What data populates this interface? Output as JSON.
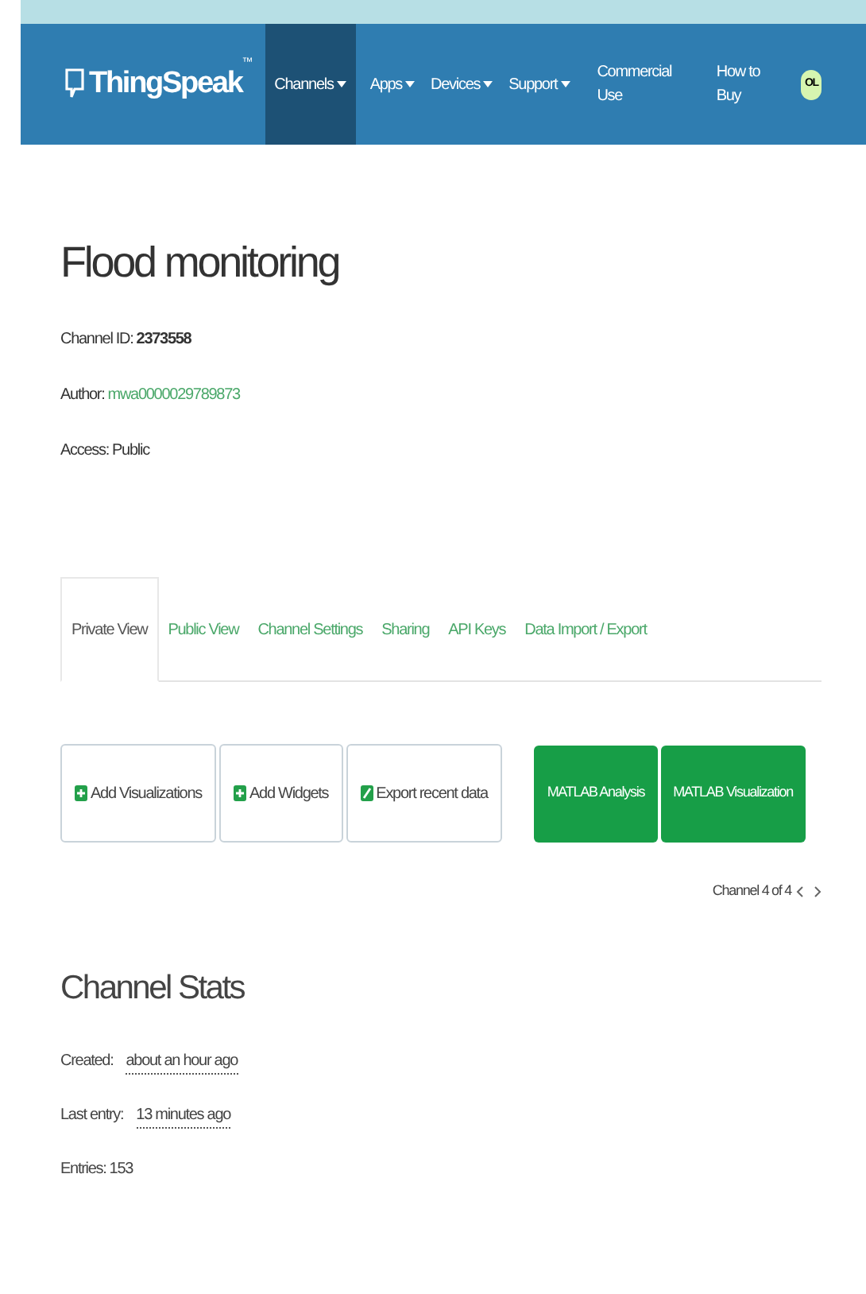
{
  "navbar": {
    "logo": "ThingSpeak",
    "trademark": "™",
    "menu": [
      {
        "label": "Channels",
        "selected": true
      },
      {
        "label": "Apps",
        "selected": false
      },
      {
        "label": "Devices",
        "selected": false
      },
      {
        "label": "Support",
        "selected": false
      }
    ],
    "links": [
      "Commercial Use",
      "How to Buy"
    ],
    "avatar": "OL"
  },
  "channel": {
    "title": "Flood monitoring",
    "info": [
      {
        "label": "Channel ID:",
        "value": "2373558",
        "kind": "bold"
      },
      {
        "label": "Author:",
        "value": "mwa0000029789873",
        "kind": "link"
      },
      {
        "label": "Access:",
        "value": "Public",
        "kind": "plain"
      }
    ]
  },
  "tabs": [
    {
      "label": "Private View",
      "selected": true
    },
    {
      "label": "Public View",
      "selected": false
    },
    {
      "label": "Channel Settings",
      "selected": false
    },
    {
      "label": "Sharing",
      "selected": false
    },
    {
      "label": "API Keys",
      "selected": false
    },
    {
      "label": "Data Import / Export",
      "selected": false
    }
  ],
  "actions": [
    {
      "label": "Add Visualizations",
      "kind": "add"
    },
    {
      "label": "Add Widgets",
      "kind": "add"
    },
    {
      "label": "Export recent data",
      "kind": "export"
    }
  ],
  "matlab_buttons": [
    "MATLAB Analysis",
    "MATLAB Visualization"
  ],
  "pager": {
    "text": "Channel 4 of 4"
  },
  "stats": {
    "title": "Channel Stats",
    "rows": [
      {
        "label": "Created:",
        "value": "about an hour ago",
        "kind": "time"
      },
      {
        "label": "Last entry:",
        "value": "13 minutes ago",
        "kind": "time"
      },
      {
        "label": "Entries:",
        "value": "153",
        "kind": "plain"
      }
    ]
  }
}
